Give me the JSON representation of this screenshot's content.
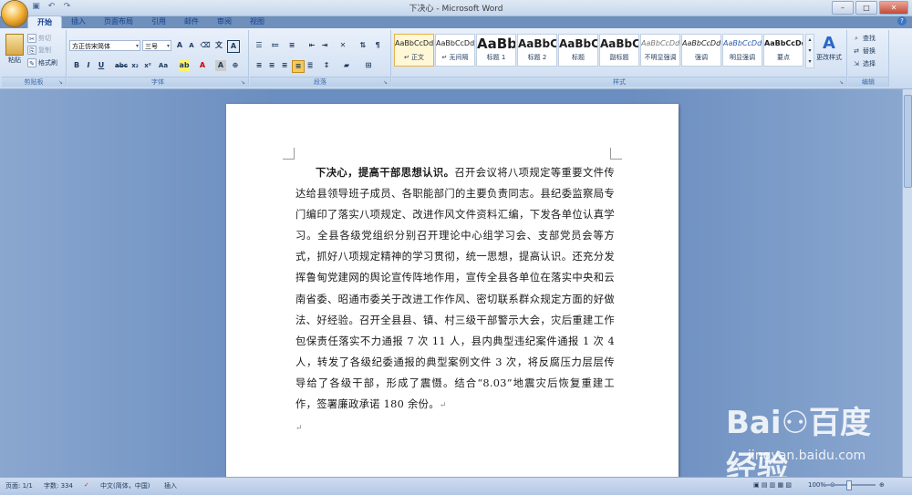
{
  "window": {
    "title": "下决心 - Microsoft Word",
    "help": "?"
  },
  "qat": [
    "save-icon",
    "undo-icon",
    "redo-icon"
  ],
  "tabs": [
    "开始",
    "插入",
    "页面布局",
    "引用",
    "邮件",
    "审阅",
    "视图"
  ],
  "ribbon": {
    "clipboard": {
      "paste": "粘贴",
      "cut": "剪切",
      "copy": "复制",
      "format_painter": "格式刷",
      "label": "剪贴板"
    },
    "font": {
      "font_name": "方正仿宋简体",
      "font_size": "三号",
      "label": "字体"
    },
    "paragraph": {
      "label": "段落"
    },
    "styles": {
      "label": "样式",
      "items": [
        {
          "sample": "AaBbCcDd",
          "name": "↵ 正文"
        },
        {
          "sample": "AaBbCcDd",
          "name": "↵ 无间隔"
        },
        {
          "sample": "AaBb",
          "name": "标题 1"
        },
        {
          "sample": "AaBbC",
          "name": "标题 2"
        },
        {
          "sample": "AaBbC",
          "name": "标题"
        },
        {
          "sample": "AaBbC",
          "name": "副标题"
        },
        {
          "sample": "AaBbCcDd",
          "name": "不明显强调"
        },
        {
          "sample": "AaBbCcDd",
          "name": "强调"
        },
        {
          "sample": "AaBbCcDd",
          "name": "明显强调"
        },
        {
          "sample": "AaBbCcDd",
          "name": "要点"
        }
      ],
      "change_styles": "更改样式"
    },
    "editing": {
      "label": "编辑",
      "find": "查找",
      "replace": "替换",
      "select": "选择"
    }
  },
  "document": {
    "lead": "下决心，提高干部思想认识。",
    "body": "召开会议将八项规定等重要文件传达给县领导班子成员、各职能部门的主要负责同志。县纪委监察局专门编印了落实八项规定、改进作风文件资料汇编，下发各单位认真学习。全县各级党组织分别召开理论中心组学习会、支部党员会等方式，抓好八项规定精神的学习贯彻，统一思想，提高认识。还充分发挥鲁甸党建网的舆论宣传阵地作用，宣传全县各单位在落实中央和云南省委、昭通市委关于改进工作作风、密切联系群众规定方面的好做法、好经验。召开全县县、镇、村三级干部警示大会，灾后重建工作包保责任落实不力通报 7 次 11 人，县内典型违纪案件通报 1 次 4 人，转发了各级纪委通报的典型案例文件 3 次，将反腐压力层层传导给了各级干部，形成了震慑。结合“8.03”地震灾后恢复重建工作，签署廉政承诺 180 余份。",
    "para_mark": "↵"
  },
  "status": {
    "page": "页面: 1/1",
    "words": "字数: 334",
    "language": "中文(简体，中国)",
    "mode": "插入",
    "zoom": "100%"
  },
  "watermark": {
    "logo": "Bai⚇百度 经验",
    "url": "jingyan.baidu.com"
  }
}
